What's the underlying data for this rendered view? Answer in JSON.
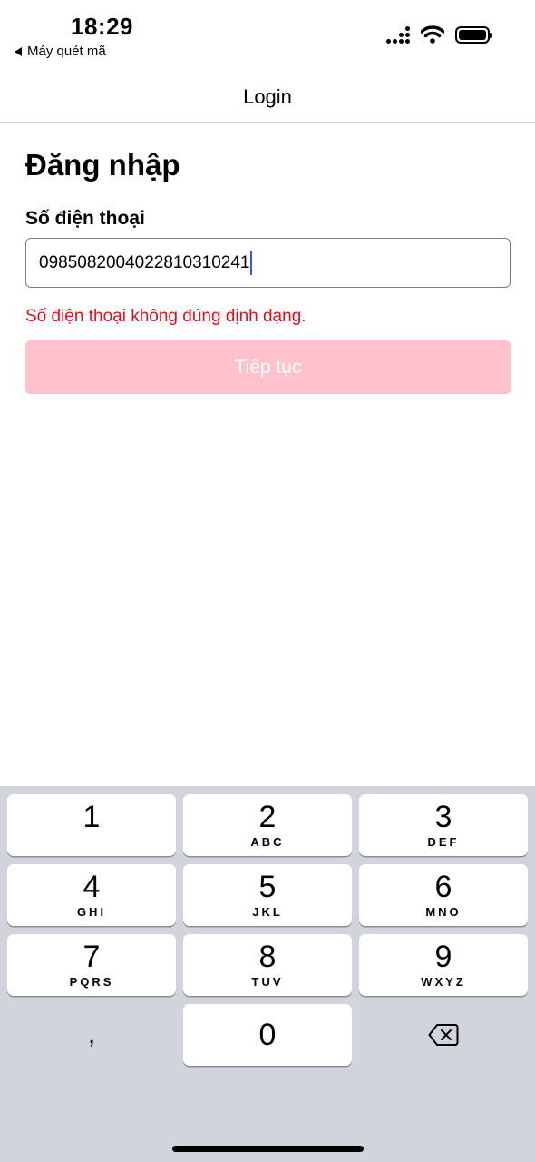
{
  "status_bar": {
    "time": "18:29",
    "back_app_label": "Máy quét mã",
    "icons": [
      "cellular-signal-icon",
      "wifi-icon",
      "battery-icon"
    ]
  },
  "nav": {
    "title": "Login"
  },
  "form": {
    "heading": "Đăng nhập",
    "phone_label": "Số điện thoại",
    "phone_value": "098508200402281031024​1",
    "error": "Số điện thoại không đúng định dạng.",
    "submit_label": "Tiếp tục"
  },
  "colors": {
    "error": "#e0101a",
    "button_disabled": "#ffc1cc",
    "keyboard_bg": "#d2d4db",
    "caret": "#2b5cff"
  },
  "keyboard": {
    "keys": [
      {
        "digit": "1",
        "letters": ""
      },
      {
        "digit": "2",
        "letters": "ABC"
      },
      {
        "digit": "3",
        "letters": "DEF"
      },
      {
        "digit": "4",
        "letters": "GHI"
      },
      {
        "digit": "5",
        "letters": "JKL"
      },
      {
        "digit": "6",
        "letters": "MNO"
      },
      {
        "digit": "7",
        "letters": "PQRS"
      },
      {
        "digit": "8",
        "letters": "TUV"
      },
      {
        "digit": "9",
        "letters": "WXYZ"
      },
      {
        "digit": "0",
        "letters": ""
      }
    ],
    "comma": ",",
    "delete_icon": "backspace-icon"
  }
}
